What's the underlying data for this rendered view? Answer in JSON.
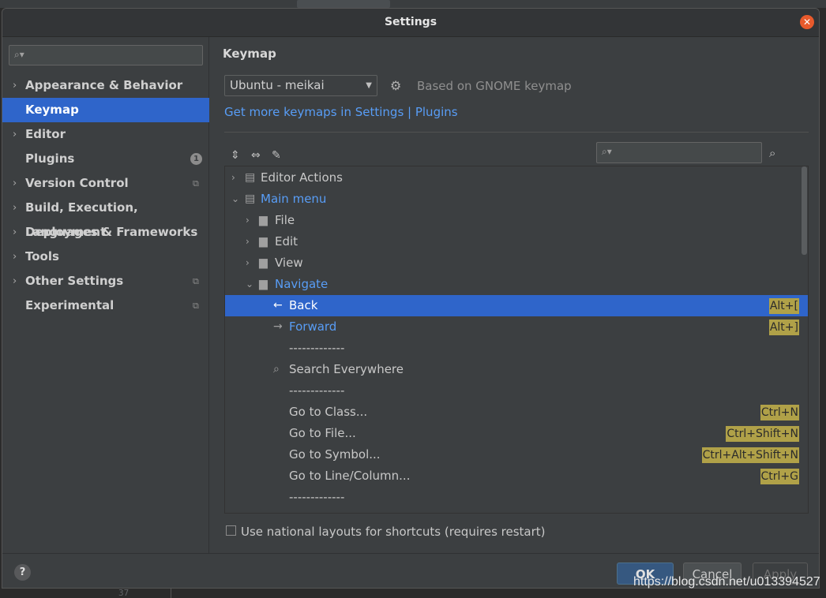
{
  "dialog": {
    "title": "Settings",
    "close_icon": "close-icon"
  },
  "sidebar": {
    "search_placeholder": "",
    "items": [
      {
        "label": "Appearance & Behavior",
        "expandable": true,
        "selected": false
      },
      {
        "label": "Keymap",
        "expandable": false,
        "selected": true
      },
      {
        "label": "Editor",
        "expandable": true,
        "selected": false
      },
      {
        "label": "Plugins",
        "expandable": false,
        "selected": false,
        "badge": "1"
      },
      {
        "label": "Version Control",
        "expandable": true,
        "selected": false,
        "project_icon": "project-settings-icon"
      },
      {
        "label": "Build, Execution, Deployment",
        "expandable": true,
        "selected": false
      },
      {
        "label": "Languages & Frameworks",
        "expandable": true,
        "selected": false
      },
      {
        "label": "Tools",
        "expandable": true,
        "selected": false
      },
      {
        "label": "Other Settings",
        "expandable": true,
        "selected": false,
        "project_icon": "project-settings-icon"
      },
      {
        "label": "Experimental",
        "expandable": false,
        "selected": false,
        "project_icon": "project-settings-icon"
      }
    ]
  },
  "keymap": {
    "section_title": "Keymap",
    "selected_keymap": "Ubuntu - meikai",
    "based_on": "Based on GNOME keymap",
    "more_link": "Get more keymaps in Settings | Plugins",
    "search_placeholder": "",
    "tree": [
      {
        "label": "Editor Actions",
        "arrow": "›",
        "icon": "editor-actions-icon",
        "blue": false,
        "selected": false,
        "shortcut": ""
      },
      {
        "label": "Main menu",
        "arrow": "⌄",
        "icon": "main-menu-icon",
        "blue": true,
        "selected": false,
        "shortcut": ""
      },
      {
        "label": "File",
        "arrow": "›",
        "icon": "folder-icon",
        "blue": false,
        "selected": false,
        "shortcut": ""
      },
      {
        "label": "Edit",
        "arrow": "›",
        "icon": "folder-icon",
        "blue": false,
        "selected": false,
        "shortcut": ""
      },
      {
        "label": "View",
        "arrow": "›",
        "icon": "folder-icon",
        "blue": false,
        "selected": false,
        "shortcut": ""
      },
      {
        "label": "Navigate",
        "arrow": "⌄",
        "icon": "folder-icon",
        "blue": true,
        "selected": false,
        "shortcut": ""
      },
      {
        "label": "Back",
        "arrow": "",
        "icon": "back-arrow-icon",
        "blue": false,
        "selected": true,
        "shortcut": "Alt+["
      },
      {
        "label": "Forward",
        "arrow": "",
        "icon": "forward-arrow-icon",
        "blue": true,
        "selected": false,
        "shortcut": "Alt+]"
      },
      {
        "label": "-------------",
        "arrow": "",
        "icon": "",
        "blue": false,
        "selected": false,
        "shortcut": ""
      },
      {
        "label": "Search Everywhere",
        "arrow": "",
        "icon": "search-icon",
        "blue": false,
        "selected": false,
        "shortcut": ""
      },
      {
        "label": "-------------",
        "arrow": "",
        "icon": "",
        "blue": false,
        "selected": false,
        "shortcut": ""
      },
      {
        "label": "Go to Class...",
        "arrow": "",
        "icon": "",
        "blue": false,
        "selected": false,
        "shortcut": "Ctrl+N"
      },
      {
        "label": "Go to File...",
        "arrow": "",
        "icon": "",
        "blue": false,
        "selected": false,
        "shortcut": "Ctrl+Shift+N"
      },
      {
        "label": "Go to Symbol...",
        "arrow": "",
        "icon": "",
        "blue": false,
        "selected": false,
        "shortcut": "Ctrl+Alt+Shift+N"
      },
      {
        "label": "Go to Line/Column...",
        "arrow": "",
        "icon": "",
        "blue": false,
        "selected": false,
        "shortcut": "Ctrl+G"
      },
      {
        "label": "-------------",
        "arrow": "",
        "icon": "",
        "blue": false,
        "selected": false,
        "shortcut": ""
      }
    ],
    "national_layouts": "Use national layouts for shortcuts (requires restart)",
    "national_layouts_checked": false
  },
  "footer": {
    "help": "?",
    "ok": "OK",
    "cancel": "Cancel",
    "apply": "Apply"
  },
  "background": {
    "line_number": "37"
  },
  "watermark": "https://blog.csdn.net/u013394527",
  "colors": {
    "selection": "#2f65ca",
    "link": "#589df6",
    "shortcut_bg": "#b0a148",
    "close_button": "#e85a2c"
  }
}
